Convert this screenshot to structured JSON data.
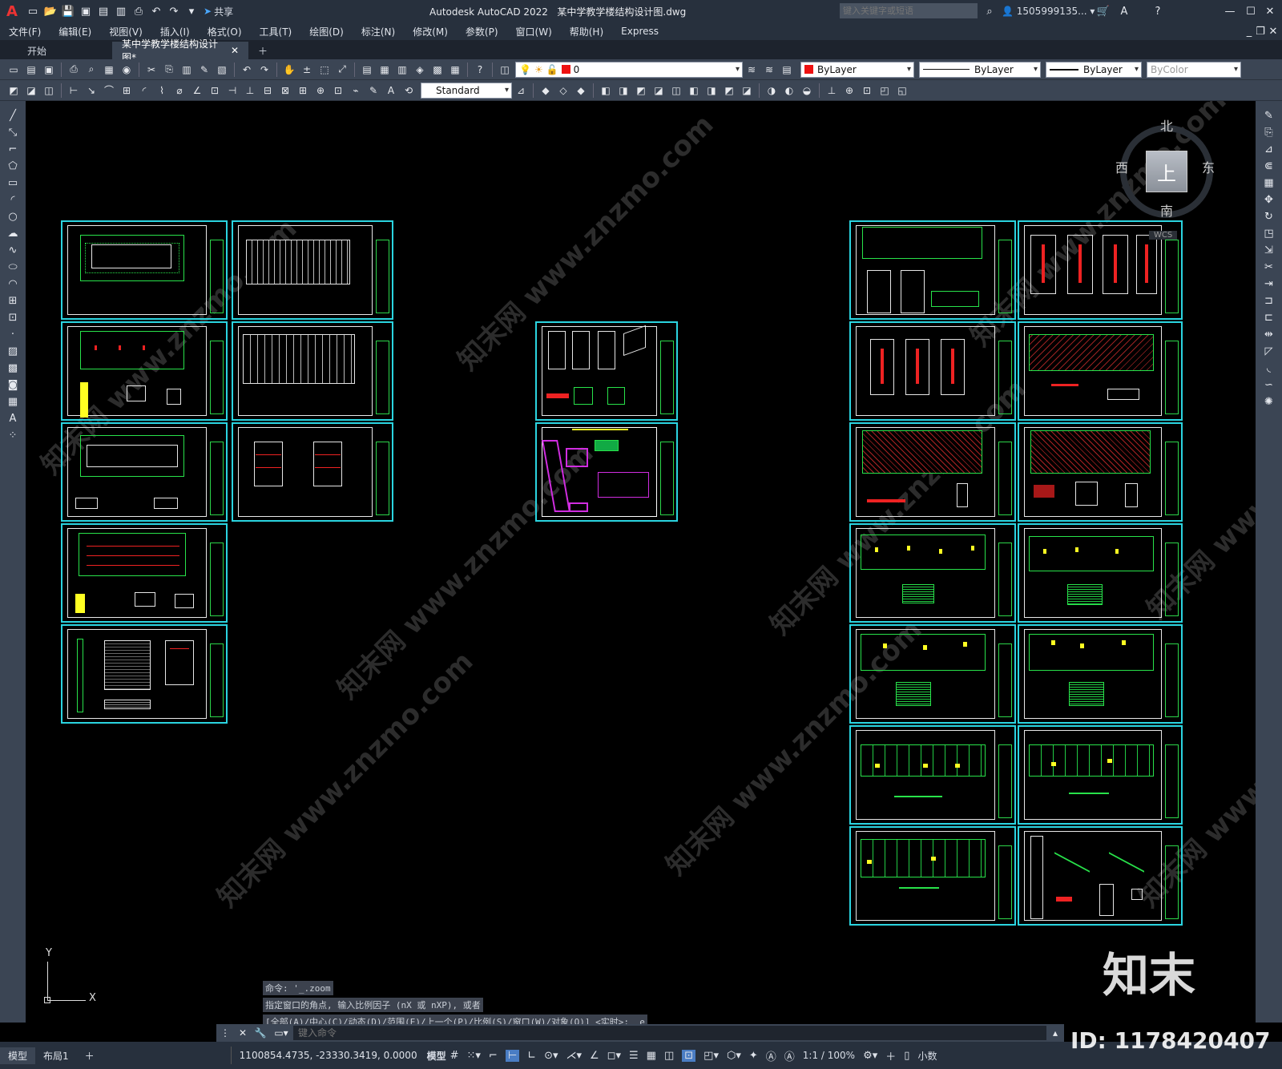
{
  "app": {
    "logo": "A",
    "title": "Autodesk AutoCAD 2022",
    "file_title": "某中学教学楼结构设计图.dwg",
    "share_label": "共享"
  },
  "search": {
    "placeholder": "键入关键字或短语",
    "user": "1505999135..."
  },
  "menu": [
    "文件(F)",
    "编辑(E)",
    "视图(V)",
    "插入(I)",
    "格式(O)",
    "工具(T)",
    "绘图(D)",
    "标注(N)",
    "修改(M)",
    "参数(P)",
    "窗口(W)",
    "帮助(H)",
    "Express"
  ],
  "tabs": [
    {
      "label": "开始"
    },
    {
      "label": "某中学教学楼结构设计图*"
    }
  ],
  "toolbar": {
    "layer": "0",
    "color": "ByLayer",
    "linetype": "ByLayer",
    "lineweight": "ByLayer",
    "plotstyle": "ByColor",
    "text_style": "Standard"
  },
  "viewcube": {
    "north": "北",
    "south": "南",
    "east": "东",
    "west": "西",
    "face": "上",
    "wcs": "WCS"
  },
  "ucs": {
    "y": "Y",
    "x": "X"
  },
  "command": {
    "history": [
      "命令: '_.zoom",
      "指定窗口的角点, 输入比例因子 (nX 或 nXP), 或者",
      "[全部(A)/中心(C)/动态(D)/范围(E)/上一个(P)/比例(S)/窗口(W)/对象(O)] <实时>: _e"
    ],
    "placeholder": "键入命令"
  },
  "status": {
    "tabs": [
      "模型",
      "布局1"
    ],
    "coords": "1100854.4735, -23330.3419, 0.0000",
    "model": "模型",
    "scale": "1:1 / 100%",
    "units": "小数"
  },
  "watermark": {
    "site": "知末网 www.znzmo.com",
    "brand": "知末",
    "id": "ID: 1178420407"
  },
  "accent": {
    "cyan": "#2bd4e0",
    "green": "#28e24a",
    "red": "#e22222",
    "magenta": "#d02de0",
    "yellow": "#ffff22"
  }
}
